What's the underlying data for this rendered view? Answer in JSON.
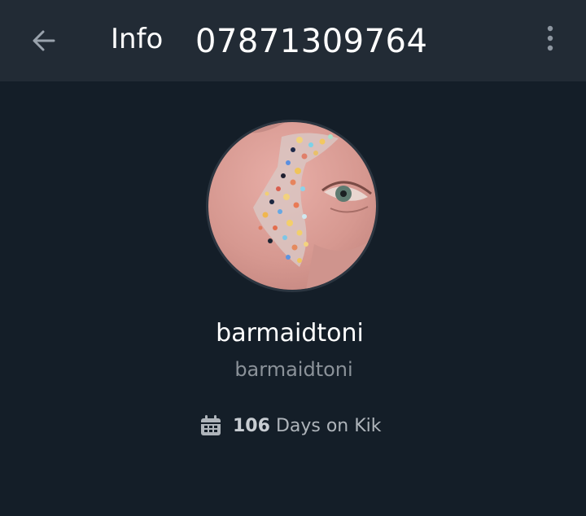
{
  "header": {
    "back_icon": "arrow-left-icon",
    "title": "Info",
    "phone": "07871309764",
    "menu_icon": "more-vertical-icon"
  },
  "profile": {
    "display_name": "barmaidtoni",
    "username": "barmaidtoni",
    "days_icon": "calendar-icon",
    "days_count": "106",
    "days_label": "Days on Kik"
  },
  "colors": {
    "background": "#141e28",
    "header_background": "#222b35",
    "text_primary": "#ffffff",
    "text_secondary": "#8b9299"
  }
}
